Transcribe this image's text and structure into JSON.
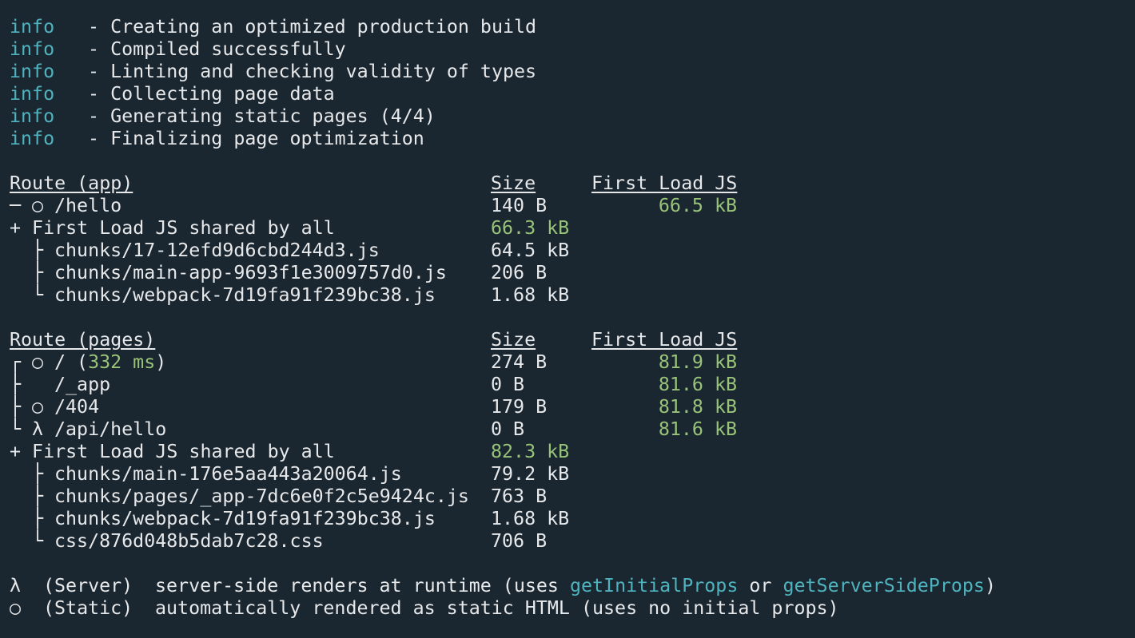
{
  "build_log": [
    {
      "level": "info",
      "message": " - Creating an optimized production build"
    },
    {
      "level": "info",
      "message": " - Compiled successfully"
    },
    {
      "level": "info",
      "message": " - Linting and checking validity of types"
    },
    {
      "level": "info",
      "message": " - Collecting page data"
    },
    {
      "level": "info",
      "message": " - Generating static pages (4/4)"
    },
    {
      "level": "info",
      "message": " - Finalizing page optimization"
    }
  ],
  "app_table": {
    "header": {
      "route": "Route (app)",
      "size": "Size",
      "first_load": "First Load JS"
    },
    "routes": [
      {
        "tree": "─",
        "symbol": "○",
        "path": "/hello",
        "size": "140 B",
        "first_load": "66.5 kB"
      }
    ],
    "shared": {
      "label": "+ First Load JS shared by all",
      "size": "66.3 kB"
    },
    "chunks": [
      {
        "tree": "├",
        "name": "chunks/17-12efd9d6cbd244d3.js",
        "size": "64.5 kB"
      },
      {
        "tree": "├",
        "name": "chunks/main-app-9693f1e3009757d0.js",
        "size": "206 B"
      },
      {
        "tree": "└",
        "name": "chunks/webpack-7d19fa91f239bc38.js",
        "size": "1.68 kB"
      }
    ]
  },
  "pages_table": {
    "header": {
      "route": "Route (pages)",
      "size": "Size",
      "first_load": "First Load JS"
    },
    "routes": [
      {
        "tree": "┌",
        "symbol": "○",
        "path": "/ (",
        "timing": "332 ms",
        "path_suffix": ")",
        "size": "274 B",
        "first_load": "81.9 kB"
      },
      {
        "tree": "├",
        "symbol": " ",
        "path": "/_app",
        "timing": "",
        "path_suffix": "",
        "size": "0 B",
        "first_load": "81.6 kB"
      },
      {
        "tree": "├",
        "symbol": "○",
        "path": "/404",
        "timing": "",
        "path_suffix": "",
        "size": "179 B",
        "first_load": "81.8 kB"
      },
      {
        "tree": "└",
        "symbol": "λ",
        "path": "/api/hello",
        "timing": "",
        "path_suffix": "",
        "size": "0 B",
        "first_load": "81.6 kB"
      }
    ],
    "shared": {
      "label": "+ First Load JS shared by all",
      "size": "82.3 kB"
    },
    "chunks": [
      {
        "tree": "├",
        "name": "chunks/main-176e5aa443a20064.js",
        "size": "79.2 kB"
      },
      {
        "tree": "├",
        "name": "chunks/pages/_app-7dc6e0f2c5e9424c.js",
        "size": "763 B"
      },
      {
        "tree": "├",
        "name": "chunks/webpack-7d19fa91f239bc38.js",
        "size": "1.68 kB"
      },
      {
        "tree": "└",
        "name": "css/876d048b5dab7c28.css",
        "size": "706 B"
      }
    ]
  },
  "legend": [
    {
      "symbol": "λ",
      "kind": "(Server)",
      "text_before": "server-side renders at runtime (uses ",
      "code1": "getInitialProps",
      "middle": " or ",
      "code2": "getServerSideProps",
      "text_after": ")"
    },
    {
      "symbol": "○",
      "kind": "(Static)",
      "text_before": "automatically rendered as static HTML (uses no initial props)",
      "code1": "",
      "middle": "",
      "code2": "",
      "text_after": ""
    }
  ],
  "colors": {
    "background": "#1b2730",
    "text": "#e6e8ea",
    "info": "#4fb3bf",
    "value_green": "#98c379",
    "code_cyan": "#4fb3bf"
  }
}
